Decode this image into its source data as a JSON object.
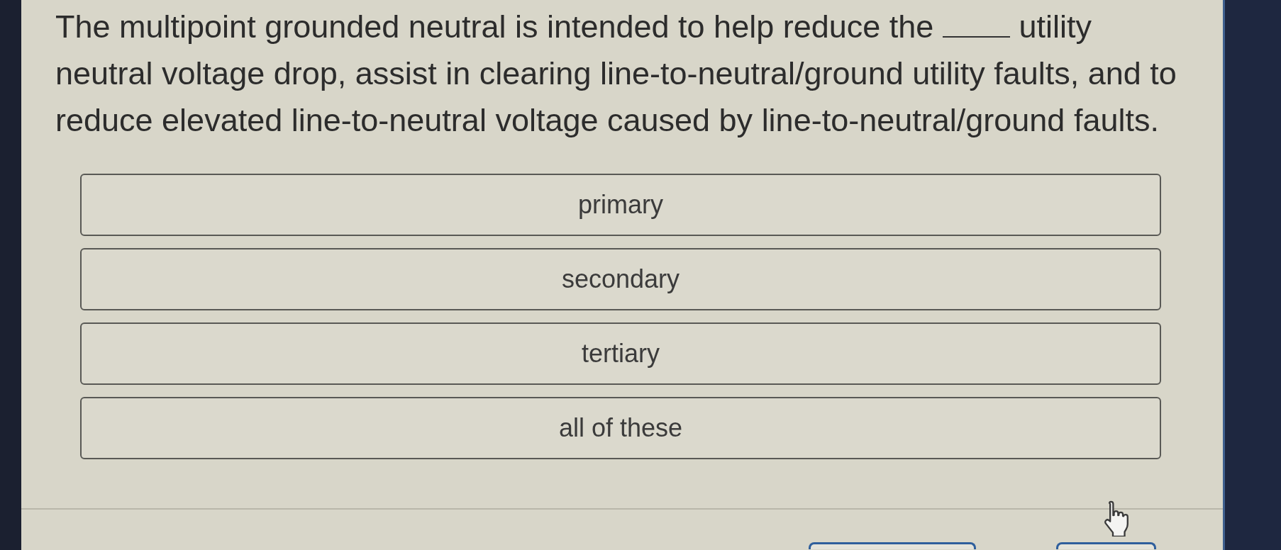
{
  "question": {
    "segments": [
      {
        "kind": "text",
        "text": "The multipoint grounded neutral is intended to help reduce the"
      },
      {
        "kind": "blank"
      },
      {
        "kind": "text",
        "text": "utility neutral voltage drop, assist in clearing line-to-neutral/ground utility faults, and to reduce elevated line-to-neutral voltage caused by line-to-neutral/ground faults."
      }
    ]
  },
  "options": [
    {
      "label": "primary",
      "selected": false
    },
    {
      "label": "secondary",
      "selected": false
    },
    {
      "label": "tertiary",
      "selected": false
    },
    {
      "label": "all of these",
      "selected": false
    }
  ],
  "footer": {
    "buttons": [
      {
        "kind": "outline"
      },
      {
        "kind": "outline"
      }
    ]
  }
}
